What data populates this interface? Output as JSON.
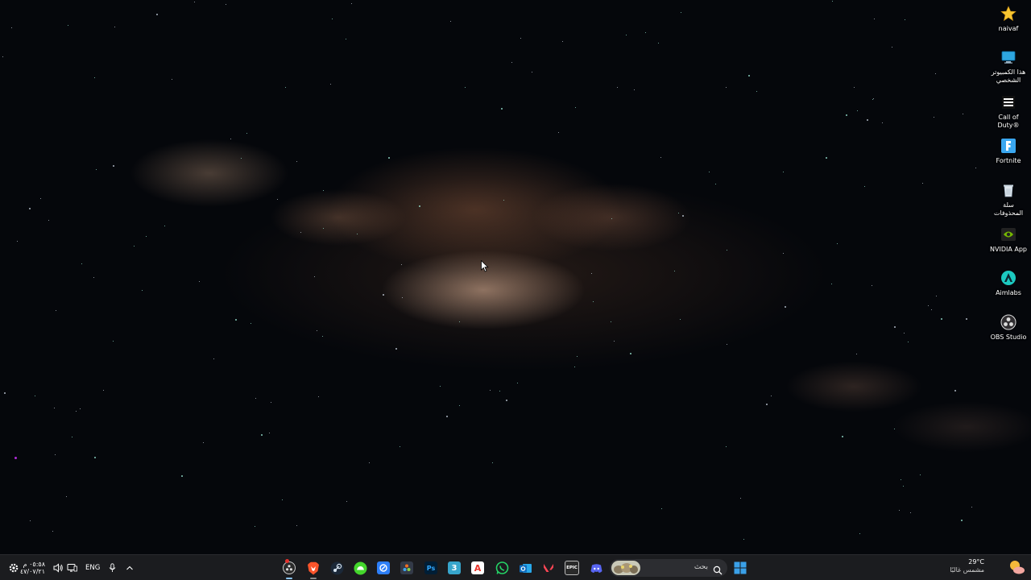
{
  "desktop": {
    "icons": [
      {
        "label": "naivaf",
        "icon": "favorites-star-icon"
      },
      {
        "label": "هذا الكمبيوتر\nالشخصي",
        "icon": "this-pc-icon"
      },
      {
        "label": "Call of\nDuty®",
        "icon": "call-of-duty-icon"
      },
      {
        "label": "Fortnite",
        "icon": "fortnite-icon"
      },
      {
        "label": "سلة\nالمحذوفات",
        "icon": "recycle-bin-icon"
      },
      {
        "label": "NVIDIA App",
        "icon": "nvidia-icon"
      },
      {
        "label": "Aimlabs",
        "icon": "aimlabs-icon"
      },
      {
        "label": "OBS Studio",
        "icon": "obs-studio-icon"
      }
    ]
  },
  "taskbar": {
    "clock": {
      "time": "٠٥:٥٨ م",
      "date": "٤٧/٠٧/٢١"
    },
    "language": "ENG",
    "search_placeholder": "بحث",
    "weather": {
      "temp": "29°C",
      "condition": "مشمس غالبًا"
    },
    "apps": [
      {
        "name": "obs-studio-taskbar-icon",
        "glyph": "",
        "color": "#2b2b2b"
      },
      {
        "name": "brave-browser-icon",
        "glyph": "",
        "color": "#fb542b"
      },
      {
        "name": "steam-icon",
        "glyph": "",
        "color": "#1b2838"
      },
      {
        "name": "razer-cortex-icon",
        "glyph": "",
        "color": "#44d62c"
      },
      {
        "name": "blue-app-icon",
        "glyph": "",
        "color": "#2d7ff9"
      },
      {
        "name": "davinci-resolve-icon",
        "glyph": "",
        "color": "#333a48"
      },
      {
        "name": "photoshop-icon",
        "glyph": "Ps",
        "color": "#001e36"
      },
      {
        "name": "3ds-max-icon",
        "glyph": "3",
        "color": "#37a5cc"
      },
      {
        "name": "adobe-acrobat-icon",
        "glyph": "A",
        "color": "#e8352b"
      },
      {
        "name": "whatsapp-icon",
        "glyph": "",
        "color": "#25d366"
      },
      {
        "name": "outlook-icon",
        "glyph": "",
        "color": "#0f6cbd"
      },
      {
        "name": "valorant-icon",
        "glyph": "",
        "color": "#ff4655"
      },
      {
        "name": "epic-games-icon",
        "glyph": "EPIC",
        "color": "#2a2a2a"
      },
      {
        "name": "discord-icon",
        "glyph": "",
        "color": "#5865f2"
      }
    ]
  },
  "colors": {
    "taskbar_bg": "#1b1c1f",
    "sky": "#05070b",
    "start_blue": "#3aa0e8"
  }
}
